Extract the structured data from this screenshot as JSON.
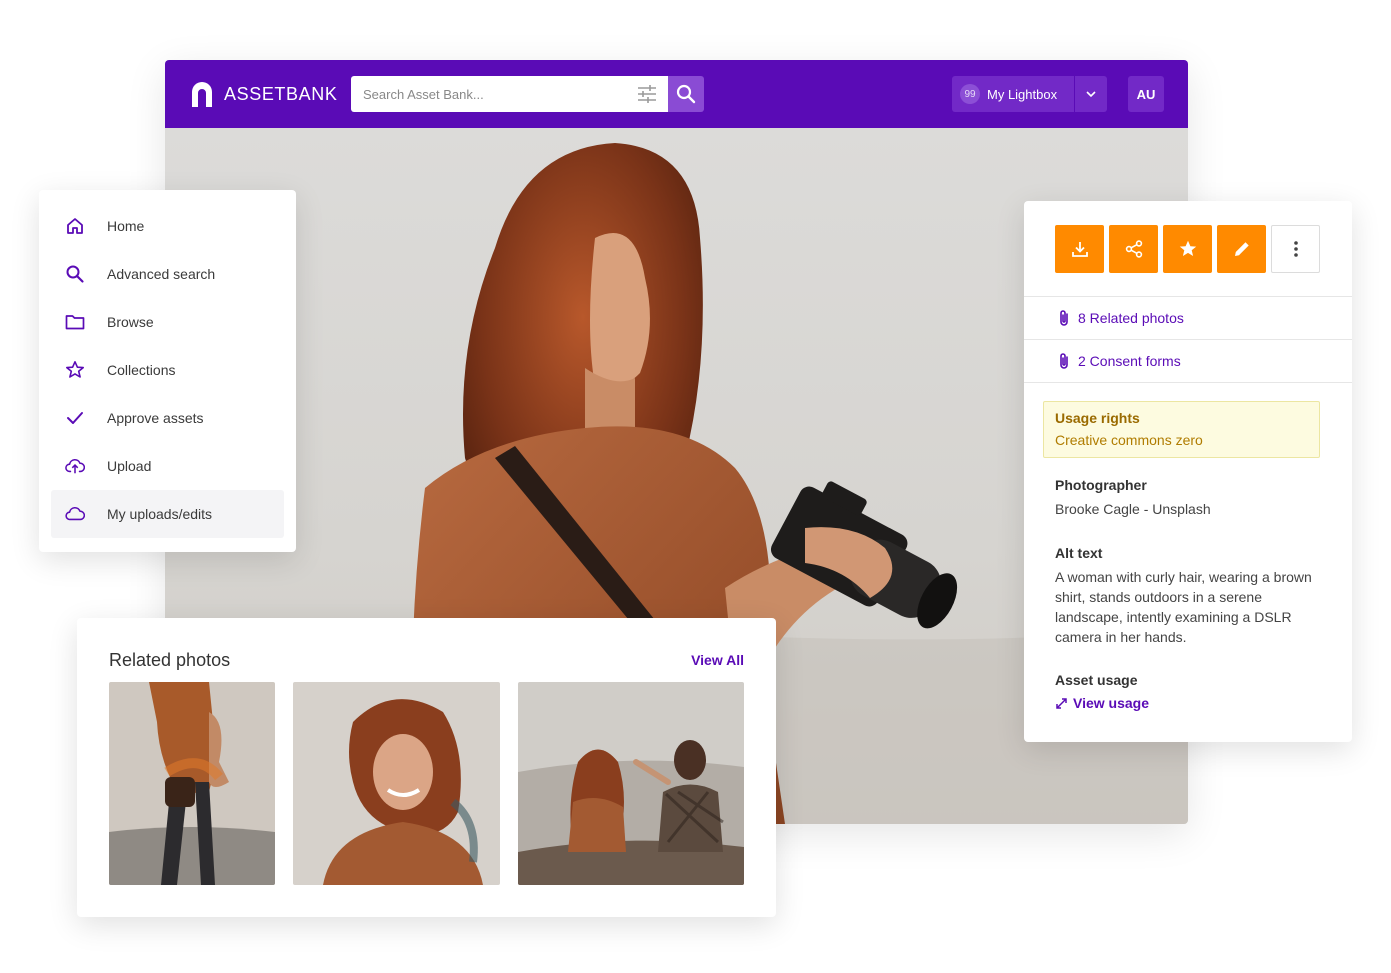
{
  "app": {
    "brand": "ASSETBANK"
  },
  "search": {
    "placeholder": "Search Asset Bank..."
  },
  "lightbox": {
    "count": "99",
    "label": "My Lightbox"
  },
  "user": {
    "initials": "AU"
  },
  "sidebar": {
    "items": [
      {
        "label": "Home",
        "icon": "home-icon"
      },
      {
        "label": "Advanced search",
        "icon": "search-icon"
      },
      {
        "label": "Browse",
        "icon": "folder-icon"
      },
      {
        "label": "Collections",
        "icon": "star-icon"
      },
      {
        "label": "Approve assets",
        "icon": "check-icon"
      },
      {
        "label": "Upload",
        "icon": "cloud-upload-icon"
      },
      {
        "label": "My uploads/edits",
        "icon": "cloud-icon"
      }
    ]
  },
  "panel": {
    "actions": [
      "download-icon",
      "share-icon",
      "star-icon",
      "edit-icon",
      "more-vertical-icon"
    ],
    "related_photos": "8 Related photos",
    "consent_forms": "2 Consent forms",
    "usage_rights_label": "Usage rights",
    "usage_rights_value": "Creative commons zero",
    "photographer_label": "Photographer",
    "photographer_value": "Brooke Cagle - Unsplash",
    "alt_text_label": "Alt text",
    "alt_text_value": "A woman with curly hair, wearing a brown shirt, stands outdoors in a serene landscape, intently examining a DSLR camera in her hands.",
    "asset_usage_label": "Asset usage",
    "view_usage": "View usage"
  },
  "related": {
    "title": "Related photos",
    "view_all": "View All"
  },
  "colors": {
    "brand": "#5a0bb6",
    "accent": "#ff8a00",
    "usage_bg": "#fdfbe0"
  }
}
